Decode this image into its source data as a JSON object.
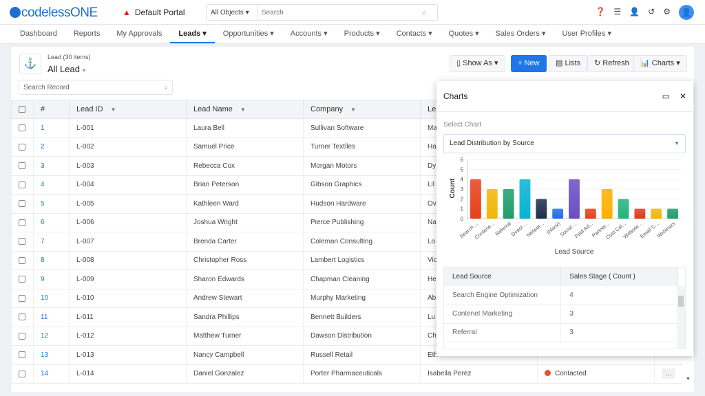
{
  "header": {
    "logo": "codelessONE",
    "portal": "Default Portal",
    "search_scope": "All Objects",
    "search_placeholder": "Search",
    "icons": [
      "help-icon",
      "database-icon",
      "add-user-icon",
      "history-icon",
      "gear-icon",
      "user-avatar-icon"
    ]
  },
  "nav": [
    {
      "label": "Dashboard"
    },
    {
      "label": "Reports"
    },
    {
      "label": "My Approvals"
    },
    {
      "label": "Leads ▾",
      "active": true
    },
    {
      "label": "Opportunities ▾"
    },
    {
      "label": "Accounts ▾"
    },
    {
      "label": "Products ▾"
    },
    {
      "label": "Contacts ▾"
    },
    {
      "label": "Quotes ▾"
    },
    {
      "label": "Sales Orders ▾"
    },
    {
      "label": "User Profiles ▾"
    }
  ],
  "list": {
    "count": "Lead (30 items)",
    "view": "All Lead",
    "search_placeholder": "Search Record"
  },
  "toolbar": {
    "show_as": "Show As ▾",
    "new": "+ New",
    "lists": "Lists",
    "refresh": "Refresh",
    "charts": "Charts ▾"
  },
  "table": {
    "headers": [
      "#",
      "Lead ID",
      "Lead Name",
      "Company",
      "Le"
    ],
    "rows": [
      [
        "1",
        "L-001",
        "Laura Bell",
        "Sullivan Software",
        "Ma"
      ],
      [
        "2",
        "L-002",
        "Samuel Price",
        "Turner Textiles",
        "Ha"
      ],
      [
        "3",
        "L-003",
        "Rebecca Cox",
        "Morgan Motors",
        "Dy"
      ],
      [
        "4",
        "L-004",
        "Brian Peterson",
        "Gibson Graphics",
        "Lil"
      ],
      [
        "5",
        "L-005",
        "Kathleen Ward",
        "Hudson Hardware",
        "Ov"
      ],
      [
        "6",
        "L-006",
        "Joshua Wright",
        "Pierce Publishing",
        "Na"
      ],
      [
        "7",
        "L-007",
        "Brenda Carter",
        "Coleman Consulting",
        "Lo"
      ],
      [
        "8",
        "L-008",
        "Christopher Ross",
        "Lambert Logistics",
        "Vic"
      ],
      [
        "9",
        "L-009",
        "Sharon Edwards",
        "Chapman Cleaning",
        "He"
      ],
      [
        "10",
        "L-010",
        "Andrew Stewart",
        "Murphy Marketing",
        "Ab"
      ],
      [
        "11",
        "L-011",
        "Sandra Phillips",
        "Bennett Builders",
        "Lu"
      ],
      [
        "12",
        "L-012",
        "Matthew Turner",
        "Dawson Distribution",
        "Ch"
      ],
      [
        "13",
        "L-013",
        "Nancy Campbell",
        "Russell Retail",
        "Eth"
      ],
      [
        "14",
        "L-014",
        "Daniel Gonzalez",
        "Porter Pharmaceuticals",
        "Isabella Perez"
      ]
    ],
    "last_status": "Contacted",
    "last_status_color": "#e8542b",
    "more": "..."
  },
  "panel": {
    "title": "Charts",
    "select_label": "Select Chart",
    "selected": "Lead Distribution by Source",
    "table_headers": [
      "Lead Source",
      "Sales Stage ( Count )"
    ],
    "table_rows": [
      [
        "Search Engine Optimization",
        "4"
      ],
      [
        "Contenet Marketing",
        "3"
      ],
      [
        "Referral",
        "3"
      ]
    ]
  },
  "chart_data": {
    "type": "bar",
    "xlabel": "Lead Source",
    "ylabel": "Count",
    "ylim": [
      0,
      6
    ],
    "yticks": [
      "0",
      "1",
      "2",
      "3",
      "4",
      "5",
      "6"
    ],
    "grid": true,
    "categories": [
      "Search ...",
      "Contene...",
      "Referral",
      "Direct ...",
      "Networ...",
      "(blank)",
      "Social ...",
      "Paid Ad...",
      "Partner...",
      "Cold Cal...",
      "Website...",
      "Email C...",
      "Webinars"
    ],
    "values": [
      4,
      3,
      3,
      4,
      2,
      1,
      4,
      1,
      3,
      2,
      1,
      1,
      1
    ],
    "colors": [
      "#e8401c",
      "#f2b705",
      "#1f9e6a",
      "#06b4d2",
      "#1f2d4d",
      "#1e6fe6",
      "#6a4ec4",
      "#e8401c",
      "#ffb000",
      "#22b57a",
      "#e03a1a",
      "#f2b705",
      "#1f9e6a"
    ]
  }
}
